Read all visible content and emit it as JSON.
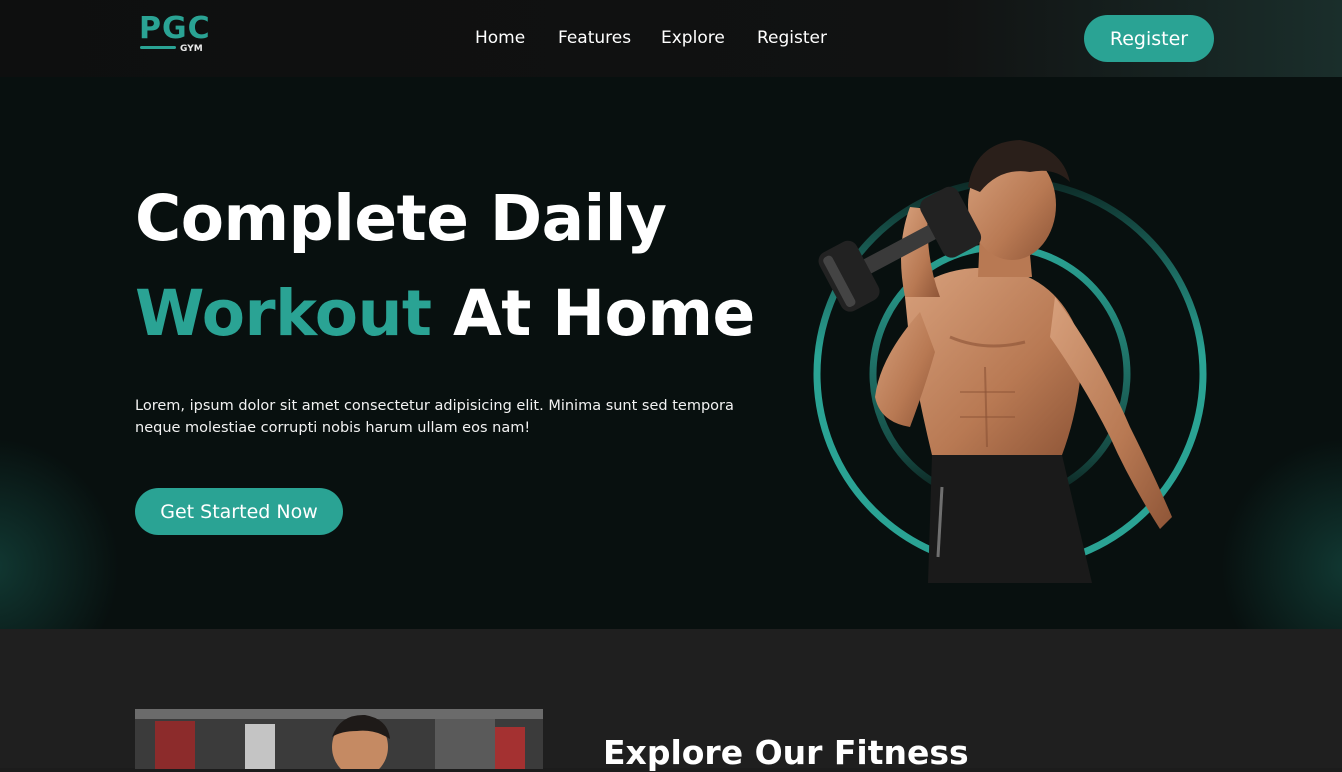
{
  "brand": {
    "logo_text": "PGC",
    "logo_sub": "GYM",
    "accent_color": "#2aa394"
  },
  "nav": {
    "items": [
      {
        "label": "Home"
      },
      {
        "label": "Features"
      },
      {
        "label": "Explore"
      },
      {
        "label": "Register"
      }
    ],
    "cta_label": "Register"
  },
  "hero": {
    "line1": "Complete Daily",
    "line2_accent": "Workout",
    "line2_rest": "At Home",
    "description": "Lorem, ipsum dolor sit amet consectetur adipisicing elit. Minima sunt sed tempora neque molestiae corrupti nobis harum ullam eos nam!",
    "cta_label": "Get Started Now"
  },
  "explore": {
    "title": "Explore Our Fitness"
  }
}
